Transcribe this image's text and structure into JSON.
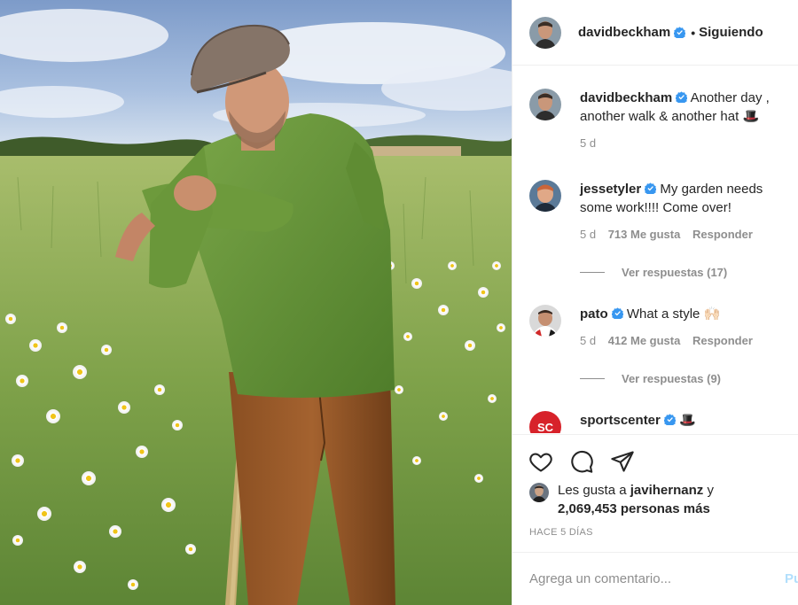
{
  "post": {
    "image_alt": "Man in tweed cap and green sweater leaning on a walking stick in a field of daisies"
  },
  "header": {
    "username": "davidbeckham",
    "separator": "•",
    "follow_state": "Siguiendo"
  },
  "caption": {
    "username": "davidbeckham",
    "text": "Another day , another walk & another hat 🎩",
    "age": "5 d"
  },
  "comments": [
    {
      "username": "jessetyler",
      "text": "My garden needs some work!!!! Come over!",
      "age": "5 d",
      "likes": "713 Me gusta",
      "reply": "Responder",
      "view_replies": "Ver respuestas (17)"
    },
    {
      "username": "pato",
      "text": "What a style 🙌🏻",
      "age": "5 d",
      "likes": "412 Me gusta",
      "reply": "Responder",
      "view_replies": "Ver respuestas (9)"
    },
    {
      "username": "sportscenter",
      "text": "🎩"
    }
  ],
  "likes": {
    "prefix": "Les gusta a",
    "liker": "javihernanz",
    "conjunction": "y",
    "count_text": "2,069,453 personas más"
  },
  "timestamp": "HACE 5 DÍAS",
  "add_comment": {
    "placeholder": "Agrega un comentario...",
    "post_label": "Pu"
  },
  "colors": {
    "verified": "#3897f0",
    "muted": "#8e8e8e",
    "text": "#262626",
    "post_disabled": "#b2dffc"
  }
}
